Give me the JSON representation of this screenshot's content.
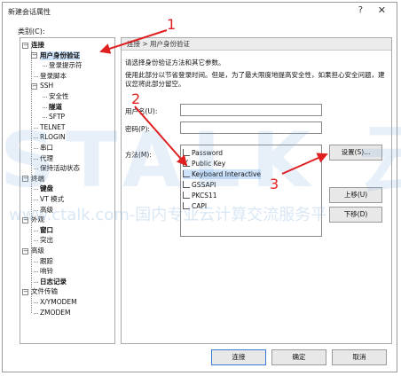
{
  "window": {
    "title": "新建会话属性",
    "help_glyph": "?",
    "close_glyph": "✕"
  },
  "category_label": "类别(C):",
  "tree": {
    "items": [
      {
        "label": "连接",
        "level": 0,
        "bold": true,
        "toggle": "−"
      },
      {
        "label": "用户身份验证",
        "level": 1,
        "bold": true,
        "toggle": "−",
        "selected": true
      },
      {
        "label": "登录提示符",
        "level": 2
      },
      {
        "label": "登录脚本",
        "level": 1
      },
      {
        "label": "SSH",
        "level": 1,
        "toggle": "−"
      },
      {
        "label": "安全性",
        "level": 2
      },
      {
        "label": "隧道",
        "level": 2,
        "bold": true
      },
      {
        "label": "SFTP",
        "level": 2
      },
      {
        "label": "TELNET",
        "level": 1
      },
      {
        "label": "RLOGIN",
        "level": 1
      },
      {
        "label": "串口",
        "level": 1
      },
      {
        "label": "代理",
        "level": 1
      },
      {
        "label": "保持活动状态",
        "level": 1
      },
      {
        "label": "终端",
        "level": 0,
        "toggle": "−"
      },
      {
        "label": "键盘",
        "level": 1,
        "bold": true
      },
      {
        "label": "VT 模式",
        "level": 1
      },
      {
        "label": "高级",
        "level": 1
      },
      {
        "label": "外观",
        "level": 0,
        "toggle": "−"
      },
      {
        "label": "窗口",
        "level": 1,
        "bold": true
      },
      {
        "label": "突出",
        "level": 1
      },
      {
        "label": "高级",
        "level": 0,
        "toggle": "−"
      },
      {
        "label": "跟踪",
        "level": 1
      },
      {
        "label": "响铃",
        "level": 1
      },
      {
        "label": "日志记录",
        "level": 1,
        "bold": true
      },
      {
        "label": "文件传输",
        "level": 0,
        "toggle": "−"
      },
      {
        "label": "X/YMODEM",
        "level": 1
      },
      {
        "label": "ZMODEM",
        "level": 1
      }
    ]
  },
  "panel": {
    "breadcrumb": "连接 > 用户身份验证",
    "desc1": "请选择身份验证方法和其它参数。",
    "desc2": "使用此部分以节省登录时间。但是，为了最大限度地提高安全性，如果担心安全问题，建",
    "desc3": "议您将此部分留空。",
    "username_label": "用户名(U):",
    "password_label": "密码(P):",
    "method_label": "方法(M):",
    "methods": [
      {
        "label": "Password",
        "checked": false
      },
      {
        "label": "Public Key",
        "checked": true
      },
      {
        "label": "Keyboard Interactive",
        "checked": false,
        "highlight": true
      },
      {
        "label": "GSSAPI",
        "checked": false
      },
      {
        "label": "PKCS11",
        "checked": false
      },
      {
        "label": "CAPI",
        "checked": false
      }
    ],
    "settings_button": "设置(S)...",
    "up_button": "上移(U)",
    "down_button": "下移(D)"
  },
  "footer": {
    "connect": "连接",
    "ok": "确定",
    "cancel": "取消"
  },
  "annotations": {
    "n1": "1",
    "n2": "2",
    "n3": "3",
    "color": "#e02020"
  },
  "watermark": {
    "big": "STALK 云",
    "small": "www.ctalk.com-国内专业云计算交流服务平"
  },
  "colors": {
    "selection": "#cfe3fa",
    "breadcrumb_bg": "#ececec",
    "primary_border": "#3a7bd5"
  }
}
